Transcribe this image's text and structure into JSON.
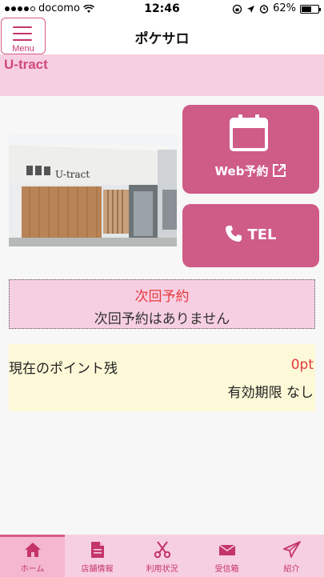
{
  "status_bar": {
    "carrier": "docomo",
    "time": "12:46",
    "battery": "62%",
    "battery_level": 0.62
  },
  "nav": {
    "menu_label": "Menu",
    "title": "ポケサロ"
  },
  "shop": {
    "name": "U-tract",
    "sign_text": "U-tract"
  },
  "actions": {
    "web_label": "Web予約",
    "tel_label": "TEL"
  },
  "next_reservation": {
    "title": "次回予約",
    "text": "次回予約はありません"
  },
  "points": {
    "label": "現在のポイント残",
    "value": "0pt",
    "expiry": "有効期限 なし"
  },
  "tabs": [
    {
      "label": "ホーム",
      "icon": "home-icon"
    },
    {
      "label": "店舗情報",
      "icon": "document-icon"
    },
    {
      "label": "利用状況",
      "icon": "scissors-icon"
    },
    {
      "label": "受信箱",
      "icon": "envelope-icon"
    },
    {
      "label": "紹介",
      "icon": "paper-plane-icon"
    }
  ],
  "colors": {
    "brand_pink": "#cf5b87",
    "light_pink": "#f7cfe2",
    "accent_red": "#e8383d",
    "points_bg": "#fdf9d8"
  }
}
